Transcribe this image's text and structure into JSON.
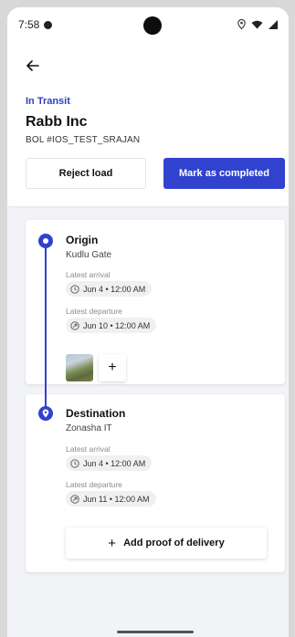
{
  "status_bar": {
    "time": "7:58"
  },
  "header": {
    "status": "In Transit",
    "company": "Rabb Inc",
    "bol": "BOL #IOS_TEST_SRAJAN",
    "reject_label": "Reject load",
    "complete_label": "Mark as completed"
  },
  "origin": {
    "title": "Origin",
    "location": "Kudlu Gate",
    "arrival_label": "Latest arrival",
    "arrival_value": "Jun 4 • 12:00 AM",
    "departure_label": "Latest departure",
    "departure_value": "Jun 10 • 12:00 AM",
    "add_photo_label": "+"
  },
  "destination": {
    "title": "Destination",
    "location": "Zonasha IT",
    "arrival_label": "Latest arrival",
    "arrival_value": "Jun 4 • 12:00 AM",
    "departure_label": "Latest departure",
    "departure_value": "Jun 11 • 12:00 AM",
    "pod_label": "Add proof of delivery",
    "pod_icon": "+"
  },
  "colors": {
    "accent": "#3142cf",
    "background": "#f2f3f6"
  }
}
